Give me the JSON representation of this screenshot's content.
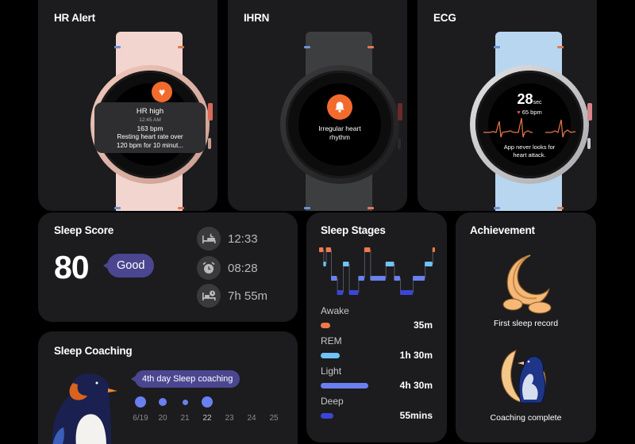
{
  "hr_alert": {
    "title": "HR Alert",
    "popup_title": "HR high",
    "time": "12:45 AM",
    "bpm": "163 bpm",
    "message_line1": "Resting heart rate over",
    "message_line2": "120 bpm for 10 minut..."
  },
  "ihrn": {
    "title": "IHRN",
    "message_line1": "Irregular heart",
    "message_line2": "rhythm"
  },
  "ecg": {
    "title": "ECG",
    "seconds": "28",
    "seconds_unit": "sec",
    "bpm": "65 bpm",
    "message_line1": "App never looks for",
    "message_line2": "heart attack."
  },
  "sleep_score": {
    "title": "Sleep Score",
    "score": "80",
    "rating": "Good",
    "bedtime": "12:33",
    "wake_time": "08:28",
    "duration": "7h 55m"
  },
  "sleep_coaching": {
    "title": "Sleep Coaching",
    "bubble": "4th day Sleep coaching",
    "days": [
      {
        "label": "6/19",
        "dot": "large"
      },
      {
        "label": "20",
        "dot": "medium"
      },
      {
        "label": "21",
        "dot": "small"
      },
      {
        "label": "22",
        "dot": "large"
      },
      {
        "label": "23",
        "dot": "none"
      },
      {
        "label": "24",
        "dot": "none"
      },
      {
        "label": "25",
        "dot": "none"
      }
    ]
  },
  "sleep_stages": {
    "title": "Sleep Stages",
    "legend": [
      {
        "name": "Awake",
        "value": "35m",
        "color": "#f0784a"
      },
      {
        "name": "REM",
        "value": "1h 30m",
        "color": "#6fc3f7"
      },
      {
        "name": "Light",
        "value": "4h 30m",
        "color": "#6a80f0"
      },
      {
        "name": "Deep",
        "value": "55mins",
        "color": "#3a45d8"
      }
    ],
    "hypnogram": [
      "Awake",
      "REM",
      "Awake",
      "Light",
      "Deep",
      "REM",
      "Deep",
      "Light",
      "Awake",
      "Light",
      "REM",
      "Light",
      "Deep",
      "Light",
      "REM",
      "Awake"
    ]
  },
  "achievement": {
    "title": "Achievement",
    "items": [
      {
        "label": "First sleep record",
        "icon": "moon-cloud-icon"
      },
      {
        "label": "Coaching complete",
        "icon": "penguin-moon-icon"
      }
    ]
  }
}
